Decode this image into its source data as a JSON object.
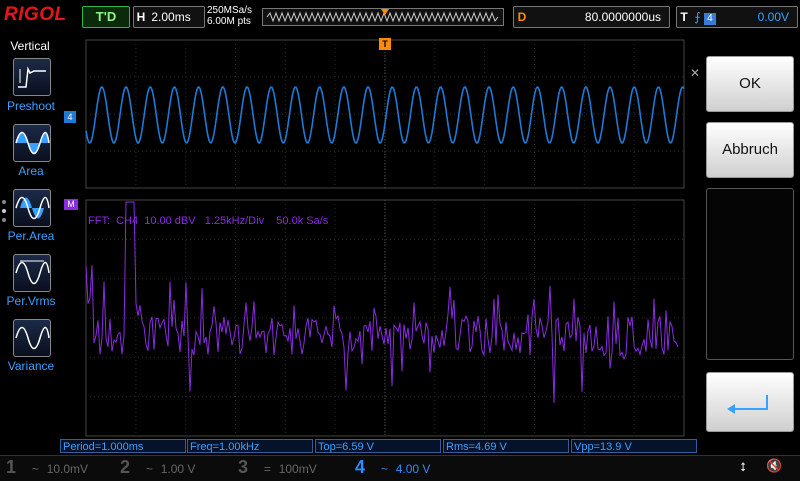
{
  "header": {
    "brand": "RIGOL",
    "run_status": "T'D",
    "horizontal": {
      "label": "H",
      "value": "2.00ms"
    },
    "sample_rate": "250MSa/s",
    "memory_depth": "6.00M pts",
    "delay": {
      "label": "D",
      "value": "80.0000000us"
    },
    "trigger": {
      "label": "T",
      "source": "4",
      "level": "0.00V"
    }
  },
  "left_menu": {
    "title": "Vertical",
    "items": [
      {
        "label": "Preshoot",
        "icon": "preshoot-icon"
      },
      {
        "label": "Area",
        "icon": "area-icon"
      },
      {
        "label": "Per.Area",
        "icon": "per-area-icon"
      },
      {
        "label": "Per.Vrms",
        "icon": "per-vrms-icon"
      },
      {
        "label": "Variance",
        "icon": "variance-icon"
      }
    ]
  },
  "right_menu": {
    "ok_label": "OK",
    "cancel_label": "Abbruch",
    "enter_icon": "return-arrow-icon",
    "close_icon": "close-icon"
  },
  "screen": {
    "ch4_marker": "4",
    "math_marker": "M",
    "trigger_marker": "T",
    "fft_info": "FFT:  CH4  10.00 dBV   1.25kHz/Div    50.0k Sa/s",
    "ch4_color": "#1e7ad6",
    "fft_color": "#8a2be2",
    "trigger_color": "#ff8c00"
  },
  "measurements": [
    {
      "label": "Period=1.000ms"
    },
    {
      "label": "Freq=1.00kHz"
    },
    {
      "label": "Top=6.59 V"
    },
    {
      "label": "Rms=4.69 V"
    },
    {
      "label": "Vpp=13.9 V"
    }
  ],
  "channels": [
    {
      "num": "1",
      "coupling": "~",
      "scale": "10.0mV",
      "color": "#d4c019"
    },
    {
      "num": "2",
      "coupling": "~",
      "scale": "1.00 V",
      "color": "#1ec8c8"
    },
    {
      "num": "3",
      "coupling": "=",
      "scale": "100mV",
      "color": "#c83cc8"
    },
    {
      "num": "4",
      "coupling": "~",
      "scale": "4.00 V",
      "color": "#2b8cff"
    }
  ]
}
